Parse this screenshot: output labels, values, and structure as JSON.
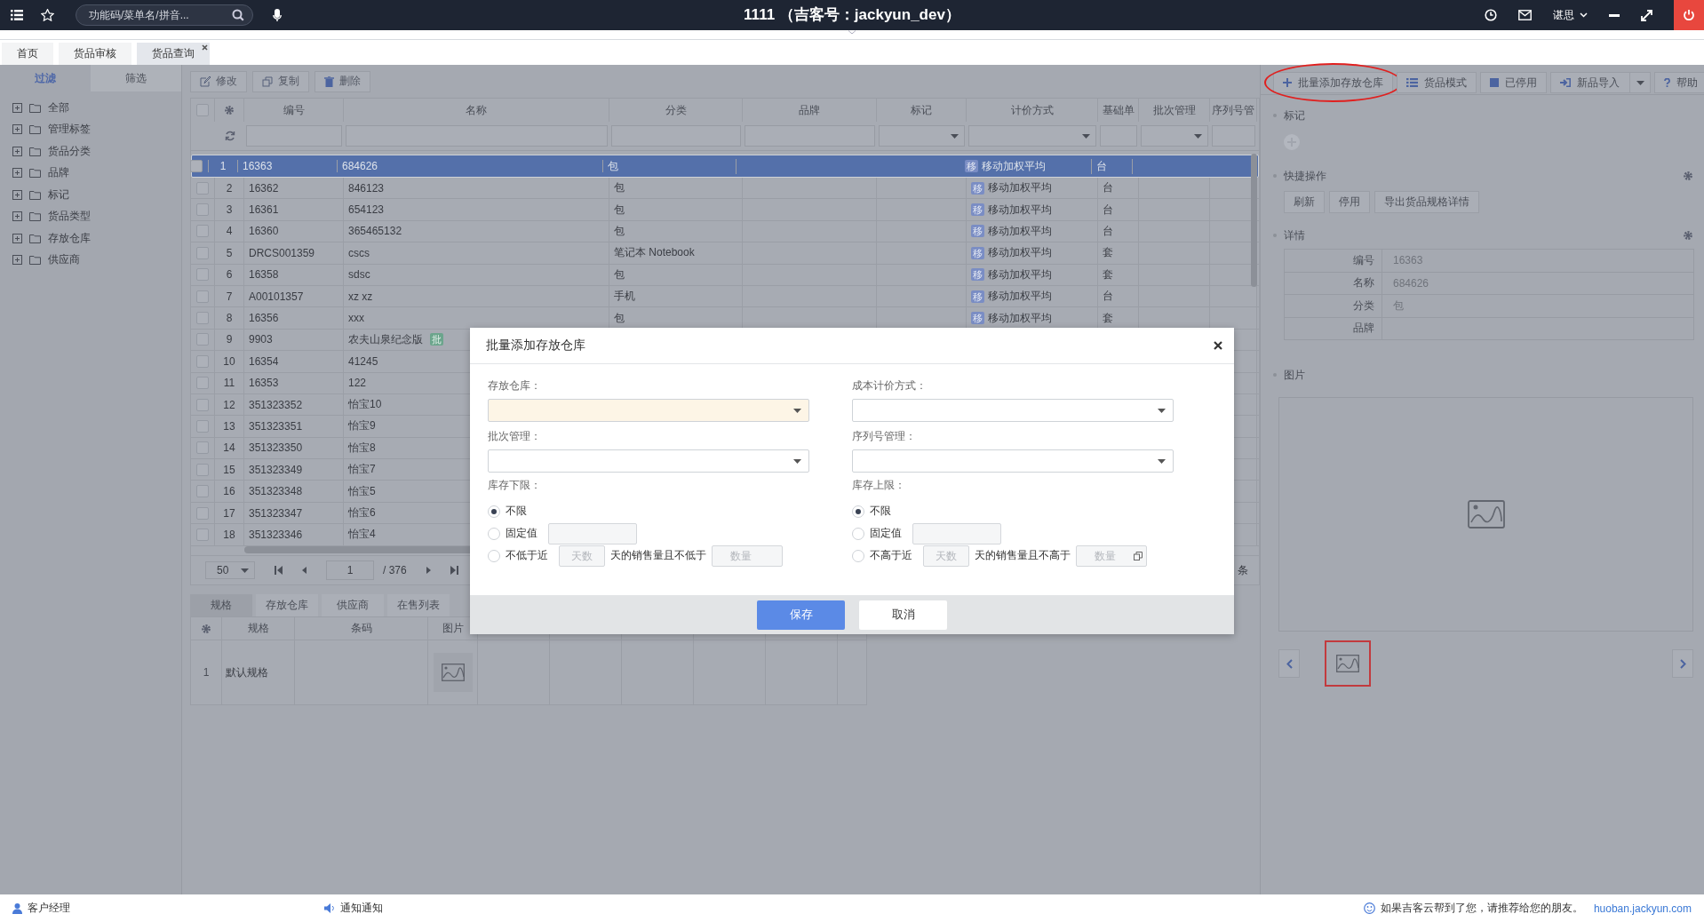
{
  "topbar": {
    "search": {
      "placeholder": "功能码/菜单名/拼音..."
    },
    "title": "1111 （吉客号：jackyun_dev）",
    "user": "谌思"
  },
  "tabs": [
    {
      "label": "首页",
      "selected": false,
      "closable": false
    },
    {
      "label": "货品审核",
      "selected": false,
      "closable": false
    },
    {
      "label": "货品查询",
      "selected": true,
      "closable": true
    }
  ],
  "sidebar": {
    "tabs": [
      {
        "label": "过滤",
        "selected": true
      },
      {
        "label": "筛选",
        "selected": false
      }
    ],
    "tree": [
      {
        "label": "全部",
        "expanded": false
      },
      {
        "label": "管理标签",
        "expanded": false
      },
      {
        "label": "货品分类",
        "expanded": false
      },
      {
        "label": "品牌",
        "expanded": false
      },
      {
        "label": "标记",
        "expanded": false
      },
      {
        "label": "货品类型",
        "expanded": false
      },
      {
        "label": "存放仓库",
        "expanded": false
      },
      {
        "label": "供应商",
        "expanded": false
      }
    ]
  },
  "toolbar": [
    "修改",
    "复制",
    "删除"
  ],
  "grid": {
    "all_checked": false,
    "columns": [
      {
        "label": "编号",
        "kind": "text"
      },
      {
        "label": "名称",
        "kind": "text"
      },
      {
        "label": "分类",
        "kind": "text"
      },
      {
        "label": "品牌",
        "kind": "text"
      },
      {
        "label": "标记",
        "kind": "select"
      },
      {
        "label": "计价方式",
        "kind": "select"
      },
      {
        "label": "基础单",
        "kind": "text"
      },
      {
        "label": "批次管理",
        "kind": "select"
      },
      {
        "label": "序列号管",
        "kind": "text"
      }
    ],
    "rows": [
      {
        "no": "1",
        "code": "16363",
        "name": "684626",
        "category": "包",
        "pricing_badge": "移",
        "pricing": "移动加权平均",
        "unit": "台",
        "selected": true,
        "checked": false
      },
      {
        "no": "2",
        "code": "16362",
        "name": "846123",
        "category": "包",
        "pricing_badge": "移",
        "pricing": "移动加权平均",
        "unit": "台",
        "selected": false,
        "checked": false
      },
      {
        "no": "3",
        "code": "16361",
        "name": "654123",
        "category": "包",
        "pricing_badge": "移",
        "pricing": "移动加权平均",
        "unit": "台",
        "selected": false,
        "checked": false
      },
      {
        "no": "4",
        "code": "16360",
        "name": "365465132",
        "category": "包",
        "pricing_badge": "移",
        "pricing": "移动加权平均",
        "unit": "台",
        "selected": false,
        "checked": false
      },
      {
        "no": "5",
        "code": "DRCS001359",
        "name": "cscs",
        "category": "笔记本 Notebook",
        "pricing_badge": "移",
        "pricing": "移动加权平均",
        "unit": "套",
        "selected": false,
        "checked": false
      },
      {
        "no": "6",
        "code": "16358",
        "name": "sdsc",
        "category": "包",
        "pricing_badge": "移",
        "pricing": "移动加权平均",
        "unit": "套",
        "selected": false,
        "checked": false
      },
      {
        "no": "7",
        "code": "A00101357",
        "name": "xz xz",
        "category": "手机",
        "pricing_badge": "移",
        "pricing": "移动加权平均",
        "unit": "台",
        "selected": false,
        "checked": false
      },
      {
        "no": "8",
        "code": "16356",
        "name": "xxx",
        "category": "包",
        "pricing_badge": "移",
        "pricing": "移动加权平均",
        "unit": "套",
        "selected": false,
        "checked": false
      },
      {
        "no": "9",
        "code": "9903",
        "name": "农夫山泉纪念版",
        "name_badge": "批",
        "selected": false,
        "checked": false
      },
      {
        "no": "10",
        "code": "16354",
        "name": "41245",
        "selected": false,
        "checked": false
      },
      {
        "no": "11",
        "code": "16353",
        "name": "122",
        "selected": false,
        "checked": false
      },
      {
        "no": "12",
        "code": "351323352",
        "name": "怡宝10",
        "selected": false,
        "checked": false
      },
      {
        "no": "13",
        "code": "351323351",
        "name": "怡宝9",
        "selected": false,
        "checked": false
      },
      {
        "no": "14",
        "code": "351323350",
        "name": "怡宝8",
        "selected": false,
        "checked": false
      },
      {
        "no": "15",
        "code": "351323349",
        "name": "怡宝7",
        "selected": false,
        "checked": false
      },
      {
        "no": "16",
        "code": "351323348",
        "name": "怡宝5",
        "selected": false,
        "checked": false
      },
      {
        "no": "17",
        "code": "351323347",
        "name": "怡宝6",
        "selected": false,
        "checked": false
      },
      {
        "no": "18",
        "code": "351323346",
        "name": "怡宝4",
        "selected": false,
        "checked": false
      }
    ]
  },
  "pagination": {
    "page_size": "50",
    "page": "1",
    "page_count": "/ 376",
    "suffix": "条"
  },
  "detail_tabs": [
    {
      "label": "规格",
      "selected": true
    },
    {
      "label": "存放仓库",
      "selected": false
    },
    {
      "label": "供应商",
      "selected": false
    },
    {
      "label": "在售列表",
      "selected": false
    }
  ],
  "spec_table": {
    "columns": [
      "规格",
      "条码",
      "图片"
    ],
    "rows": [
      {
        "no": "1",
        "spec": "默认规格"
      }
    ]
  },
  "actions": [
    {
      "label": "批量添加存放仓库",
      "highlighted": true,
      "dropdown": false
    },
    {
      "label": "货品模式",
      "highlighted": false,
      "dropdown": false
    },
    {
      "label": "已停用",
      "highlighted": false,
      "dropdown": false
    },
    {
      "label": "新品导入",
      "highlighted": false,
      "dropdown": true
    },
    {
      "label": "帮助",
      "highlighted": false,
      "dropdown": false
    }
  ],
  "panel": {
    "marks": {
      "title": "标记"
    },
    "quick": {
      "title": "快捷操作",
      "buttons": [
        "刷新",
        "停用",
        "导出货品规格详情"
      ]
    },
    "details": {
      "title": "详情",
      "fields": [
        {
          "label": "编号",
          "value": "16363"
        },
        {
          "label": "名称",
          "value": "684626"
        },
        {
          "label": "分类",
          "value": "包"
        },
        {
          "label": "品牌"
        }
      ]
    },
    "images": {
      "title": "图片",
      "thumbnails": [
        {
          "selected": true
        }
      ]
    }
  },
  "dialog": {
    "title": "批量添加存放仓库",
    "fields": [
      {
        "label": "存放仓库：",
        "required": true
      },
      {
        "label": "成本计价方式：",
        "required": false
      },
      {
        "label": "批次管理：",
        "required": false
      },
      {
        "label": "序列号管理：",
        "required": false
      }
    ],
    "limits": [
      {
        "title": "库存下限：",
        "options": [
          {
            "kind": "plain",
            "label": "不限",
            "selected": true
          },
          {
            "kind": "fixed",
            "label": "固定值",
            "selected": false
          },
          {
            "kind": "recent",
            "label": "不低于近",
            "days_placeholder": "天数",
            "middle": "天的销售量且不低于",
            "qty_placeholder": "数量",
            "qty_icon": false,
            "selected": false
          }
        ]
      },
      {
        "title": "库存上限：",
        "options": [
          {
            "kind": "plain",
            "label": "不限",
            "selected": true
          },
          {
            "kind": "fixed",
            "label": "固定值",
            "selected": false
          },
          {
            "kind": "recent",
            "label": "不高于近",
            "days_placeholder": "天数",
            "middle": "天的销售量且不高于",
            "qty_placeholder": "数量",
            "qty_icon": true,
            "selected": false
          }
        ]
      }
    ],
    "buttons": [
      {
        "label": "保存",
        "kind": "primary"
      },
      {
        "label": "取消",
        "kind": "default"
      }
    ]
  },
  "status_bar": {
    "manager": "客户经理",
    "notice": "通知通知",
    "message": "如果吉客云帮到了您，请推荐给您的朋友。",
    "link": "huoban.jackyun.com"
  }
}
